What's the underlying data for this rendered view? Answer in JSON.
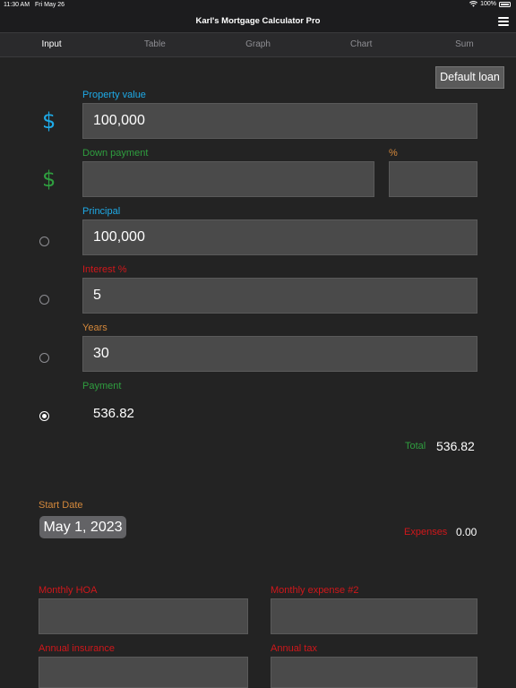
{
  "status": {
    "time": "11:30 AM",
    "date": "Fri May 26",
    "battery": "100%"
  },
  "nav": {
    "title": "Karl's Mortgage Calculator Pro"
  },
  "tabs": [
    {
      "label": "Input",
      "active": true
    },
    {
      "label": "Table"
    },
    {
      "label": "Graph"
    },
    {
      "label": "Chart"
    },
    {
      "label": "Sum"
    }
  ],
  "default_loan_label": "Default loan",
  "fields": {
    "property_value": {
      "label": "Property value",
      "value": "100,000"
    },
    "down_payment": {
      "label": "Down payment",
      "value": ""
    },
    "down_payment_pct": {
      "label": "%",
      "value": ""
    },
    "principal": {
      "label": "Principal",
      "value": "100,000"
    },
    "interest": {
      "label": "Interest %",
      "value": "5"
    },
    "years": {
      "label": "Years",
      "value": "30"
    },
    "payment": {
      "label": "Payment",
      "value": "536.82"
    }
  },
  "dollar_symbol": "$",
  "total": {
    "label": "Total",
    "value": "536.82"
  },
  "start_date": {
    "label": "Start Date",
    "value": "May 1, 2023"
  },
  "expenses": {
    "label": "Expenses",
    "value": "0.00"
  },
  "monthly_hoa": {
    "label": "Monthly HOA",
    "value": ""
  },
  "monthly_expense_2": {
    "label": "Monthly expense #2",
    "value": ""
  },
  "annual_insurance": {
    "label": "Annual insurance",
    "value": ""
  },
  "annual_tax": {
    "label": "Annual tax",
    "value": ""
  },
  "colors": {
    "blue": "#1eaae7",
    "green": "#2f9e3f",
    "red": "#d0171b",
    "orange": "#d4883b",
    "background": "#232323",
    "field": "#4a4a4a"
  }
}
